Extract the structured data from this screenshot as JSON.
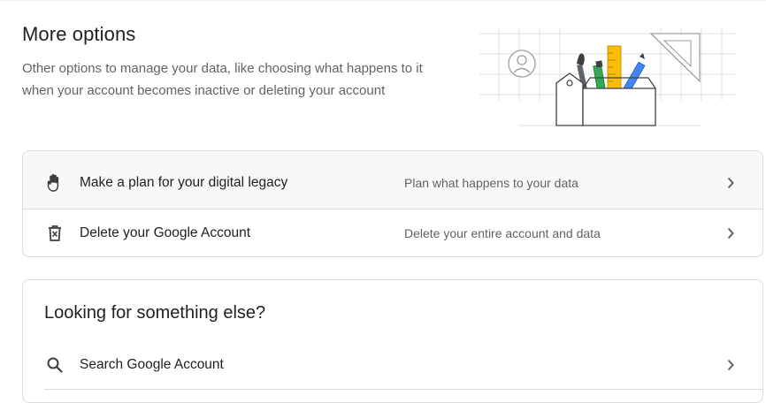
{
  "section": {
    "title": "More options",
    "description": "Other options to manage your data, like choosing what happens to it when your account becomes inactive or deleting your account"
  },
  "options": [
    {
      "icon": "hand-icon",
      "title": "Make a plan for your digital legacy",
      "description": "Plan what happens to your data"
    },
    {
      "icon": "trash-icon",
      "title": "Delete your Google Account",
      "description": "Delete your entire account and data"
    }
  ],
  "else_card": {
    "title": "Looking for something else?",
    "search_label": "Search Google Account"
  },
  "colors": {
    "text_primary": "#202124",
    "text_secondary": "#5f6368",
    "border": "#dadce0",
    "illustration_yellow": "#fbbc04",
    "illustration_green": "#34a853",
    "illustration_blue": "#4285f4",
    "illustration_red": "#ea4335"
  }
}
